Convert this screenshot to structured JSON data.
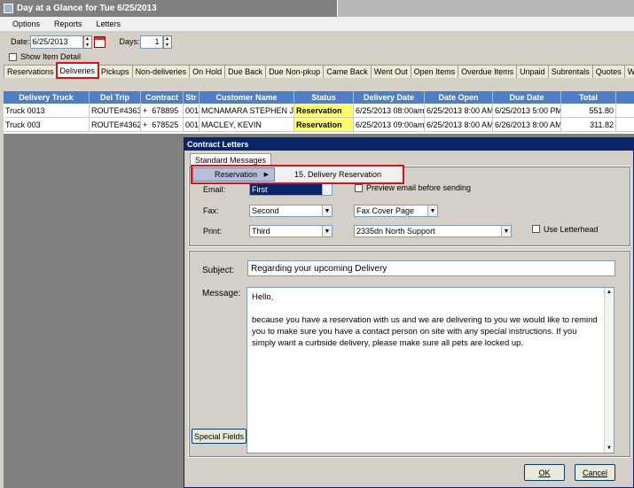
{
  "window": {
    "title": "Day at a Glance for Tue 6/25/2013"
  },
  "menu": [
    "Options",
    "Reports",
    "Letters"
  ],
  "datebar": {
    "date_label": "Date:",
    "date_value": "6/25/2013",
    "days_label": "Days:",
    "days_value": "1"
  },
  "show_item_detail": "Show Item Detail",
  "tabs": [
    "Reservations",
    "Deliveries",
    "Pickups",
    "Non-deliveries",
    "On Hold",
    "Due Back",
    "Due Non-pkup",
    "Came Back",
    "Went Out",
    "Open Items",
    "Overdue Items",
    "Unpaid",
    "Subrentals",
    "Quotes",
    "Wor"
  ],
  "grid": {
    "headers": [
      "Delivery Truck",
      "Del Trip",
      "Contract",
      "Str",
      "Customer Name",
      "Status",
      "Delivery Date",
      "Date Open",
      "Due Date",
      "Total"
    ],
    "rows": [
      {
        "truck": "Truck 0013",
        "trip": "ROUTE#4363",
        "plus": "+",
        "contract": "678895",
        "str": "001",
        "customer": "MCNAMARA STEPHEN J",
        "status": "Reservation",
        "delivery": "6/25/2013 08:00am",
        "open": "6/25/2013 8:00 AM",
        "due": "6/25/2013 5:00 PM",
        "total": "551.80"
      },
      {
        "truck": "Truck 003",
        "trip": "ROUTE#4362",
        "plus": "+",
        "contract": "678525",
        "str": "001",
        "customer": "MACLEY, KEVIN",
        "status": "Reservation",
        "delivery": "6/25/2013 09:00am",
        "open": "6/25/2013 8:00 AM",
        "due": "6/26/2013 8:00 AM",
        "total": "311.82"
      }
    ]
  },
  "dialog": {
    "title": "Contract Letters",
    "tab": "Standard Messages",
    "menu_item": "Reservation",
    "submenu_item": "15. Delivery Reservation",
    "email_label": "Email:",
    "email_value": "First",
    "preview_label": "Preview email before sending",
    "fax_label": "Fax:",
    "fax_value": "Second",
    "fax_cover": "Fax Cover Page",
    "print_label": "Print:",
    "print_value": "Third",
    "printer": "2335dn North Support",
    "letterhead_label": "Use Letterhead",
    "subject_label": "Subject:",
    "subject_value": "Regarding your upcoming Delivery",
    "message_label": "Message:",
    "message_greeting": "Hello,",
    "message_body": "because you have a reservation with us and we are delivering to you we would like to remind  you to make sure you have a contact person on site with any special instructions. If you simply want a curbside delivery, please make sure all pets are locked up.",
    "special_fields": "Special Fields",
    "ok": "OK",
    "cancel": "Cancel"
  }
}
